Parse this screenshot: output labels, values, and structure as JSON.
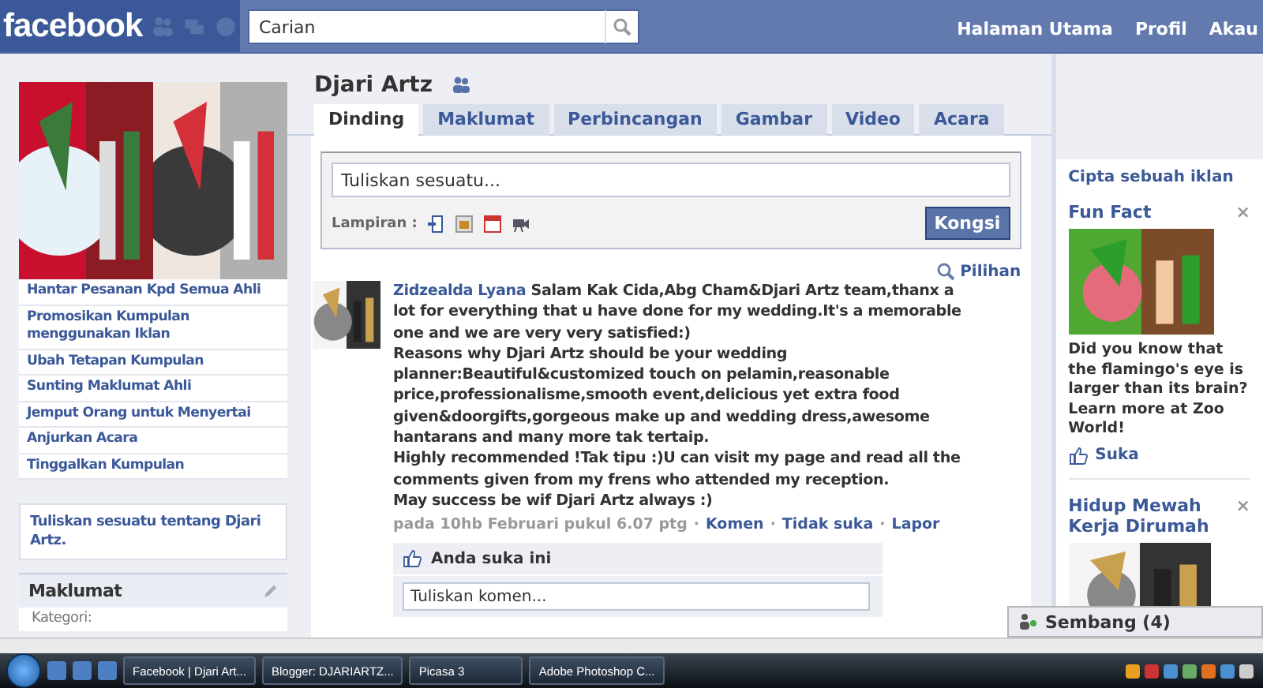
{
  "topbar": {
    "logo": "facebook",
    "search": {
      "placeholder": "Carian"
    },
    "nav": [
      "Halaman Utama",
      "Profil",
      "Akau"
    ]
  },
  "sidebar": {
    "links": [
      "Hantar Pesanan Kpd Semua Ahli",
      "Promosikan Kumpulan menggunakan Iklan",
      "Ubah Tetapan Kumpulan",
      "Sunting Maklumat Ahli",
      "Jemput Orang untuk Menyertai",
      "Anjurkan Acara",
      "Tinggalkan Kumpulan"
    ],
    "write_about": "Tuliskan sesuatu tentang Djari Artz.",
    "info": {
      "title": "Maklumat",
      "label": "Kategori:"
    }
  },
  "group": {
    "title": "Djari Artz"
  },
  "tabs": [
    {
      "label": "Dinding",
      "selected": true
    },
    {
      "label": "Maklumat",
      "selected": false
    },
    {
      "label": "Perbincangan",
      "selected": false
    },
    {
      "label": "Gambar",
      "selected": false
    },
    {
      "label": "Video",
      "selected": false
    },
    {
      "label": "Acara",
      "selected": false
    }
  ],
  "composer": {
    "placeholder": "Tuliskan sesuatu...",
    "attach_label": "Lampiran :",
    "share": "Kongsi"
  },
  "options": "Pilihan",
  "post": {
    "author": "Zidzealda Lyana",
    "text": "Salam Kak Cida,Abg Cham&Djari Artz team,thanx a lot for everything that u have done for my wedding.It's a memorable one and we are very very satisfied:)\nReasons why Djari Artz should be your wedding planner:Beautiful&customized touch on pelamin,reasonable price,professionalisme,smooth event,delicious yet extra food given&doorgifts,gorgeous make up and wedding dress,awesome hantarans and many more tak tertaip.\nHighly recommended !Tak tipu :)U can visit my page and read all the comments given from my frens who attended my reception.\nMay success be wif Djari Artz always :)",
    "time": "pada 10hb Februari pukul 6.07 ptg",
    "actions": [
      "Komen",
      "Tidak suka",
      "Lapor"
    ],
    "separator": "·",
    "likes": "Anda suka ini",
    "comment_placeholder": "Tuliskan komen..."
  },
  "ads": {
    "create": "Cipta sebuah iklan",
    "items": [
      {
        "title": "Fun Fact",
        "body": "Did you know that the flamingo's eye is larger than its brain? Learn more at Zoo World!",
        "like": "Suka",
        "close": "×"
      },
      {
        "title": "Hidup Mewah Kerja Dirumah",
        "close": "×"
      }
    ]
  },
  "chat": {
    "label": "Sembang (4)"
  },
  "taskbar": {
    "tasks": [
      "Facebook | Djari Art...",
      "Blogger: DJARIARTZ...",
      "Picasa 3",
      "Adobe Photoshop C..."
    ]
  }
}
